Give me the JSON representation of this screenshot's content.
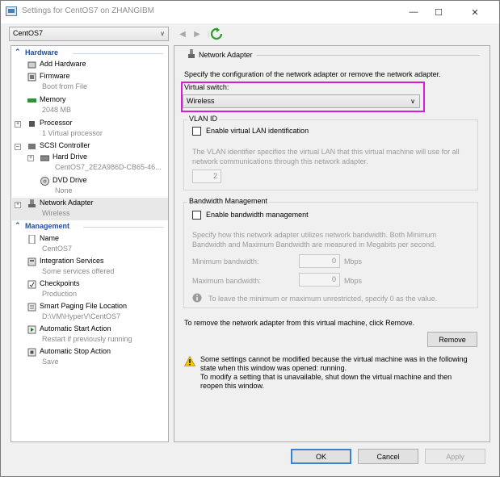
{
  "window": {
    "title": "Settings for CentOS7 on ZHANGIBM"
  },
  "vm_selector": {
    "value": "CentOS7"
  },
  "tree": {
    "hardware_header": "Hardware",
    "management_header": "Management",
    "hardware": [
      {
        "label": "Add Hardware",
        "sub": ""
      },
      {
        "label": "Firmware",
        "sub": "Boot from File"
      },
      {
        "label": "Memory",
        "sub": "2048 MB"
      },
      {
        "label": "Processor",
        "sub": "1 Virtual processor"
      },
      {
        "label": "SCSI Controller",
        "sub": ""
      },
      {
        "label": "Hard Drive",
        "sub": "CentOS7_2E2A986D-CB65-46..."
      },
      {
        "label": "DVD Drive",
        "sub": "None"
      },
      {
        "label": "Network Adapter",
        "sub": "Wireless"
      }
    ],
    "management": [
      {
        "label": "Name",
        "sub": "CentOS7"
      },
      {
        "label": "Integration Services",
        "sub": "Some services offered"
      },
      {
        "label": "Checkpoints",
        "sub": "Production"
      },
      {
        "label": "Smart Paging File Location",
        "sub": "D:\\VM\\HyperV\\CentOS7"
      },
      {
        "label": "Automatic Start Action",
        "sub": "Restart if previously running"
      },
      {
        "label": "Automatic Stop Action",
        "sub": "Save"
      }
    ]
  },
  "panel": {
    "header": "Network Adapter",
    "description": "Specify the configuration of the network adapter or remove the network adapter.",
    "virtual_switch_label": "Virtual switch:",
    "virtual_switch_value": "Wireless",
    "vlan_group": "VLAN ID",
    "vlan_checkbox": "Enable virtual LAN identification",
    "vlan_desc_1": "The VLAN identifier specifies the virtual LAN that this virtual machine will use for all",
    "vlan_desc_2": "network communications through this network adapter.",
    "vlan_value": "2",
    "bandwidth_group": "Bandwidth Management",
    "bandwidth_checkbox": "Enable bandwidth management",
    "bw_desc_1": "Specify how this network adapter utilizes network bandwidth. Both Minimum",
    "bw_desc_2": "Bandwidth and Maximum Bandwidth are measured in Megabits per second.",
    "min_bw_label": "Minimum bandwidth:",
    "min_bw_value": "0",
    "max_bw_label": "Maximum bandwidth:",
    "max_bw_value": "0",
    "unit": "Mbps",
    "bw_info": "To leave the minimum or maximum unrestricted, specify 0 as the value.",
    "remove_desc": "To remove the network adapter from this virtual machine, click Remove.",
    "remove_button": "Remove",
    "warning_1": "Some settings cannot be modified because the virtual machine was in the following",
    "warning_2": "state when this window was opened: running.",
    "warning_3": "To modify a setting that is unavailable, shut down the virtual machine and then",
    "warning_4": "reopen this window."
  },
  "buttons": {
    "ok": "OK",
    "cancel": "Cancel",
    "apply": "Apply"
  },
  "colors": {
    "highlight": "#d81bd8",
    "section_header": "#1f4e9e",
    "default_button": "#3c7fd1"
  }
}
